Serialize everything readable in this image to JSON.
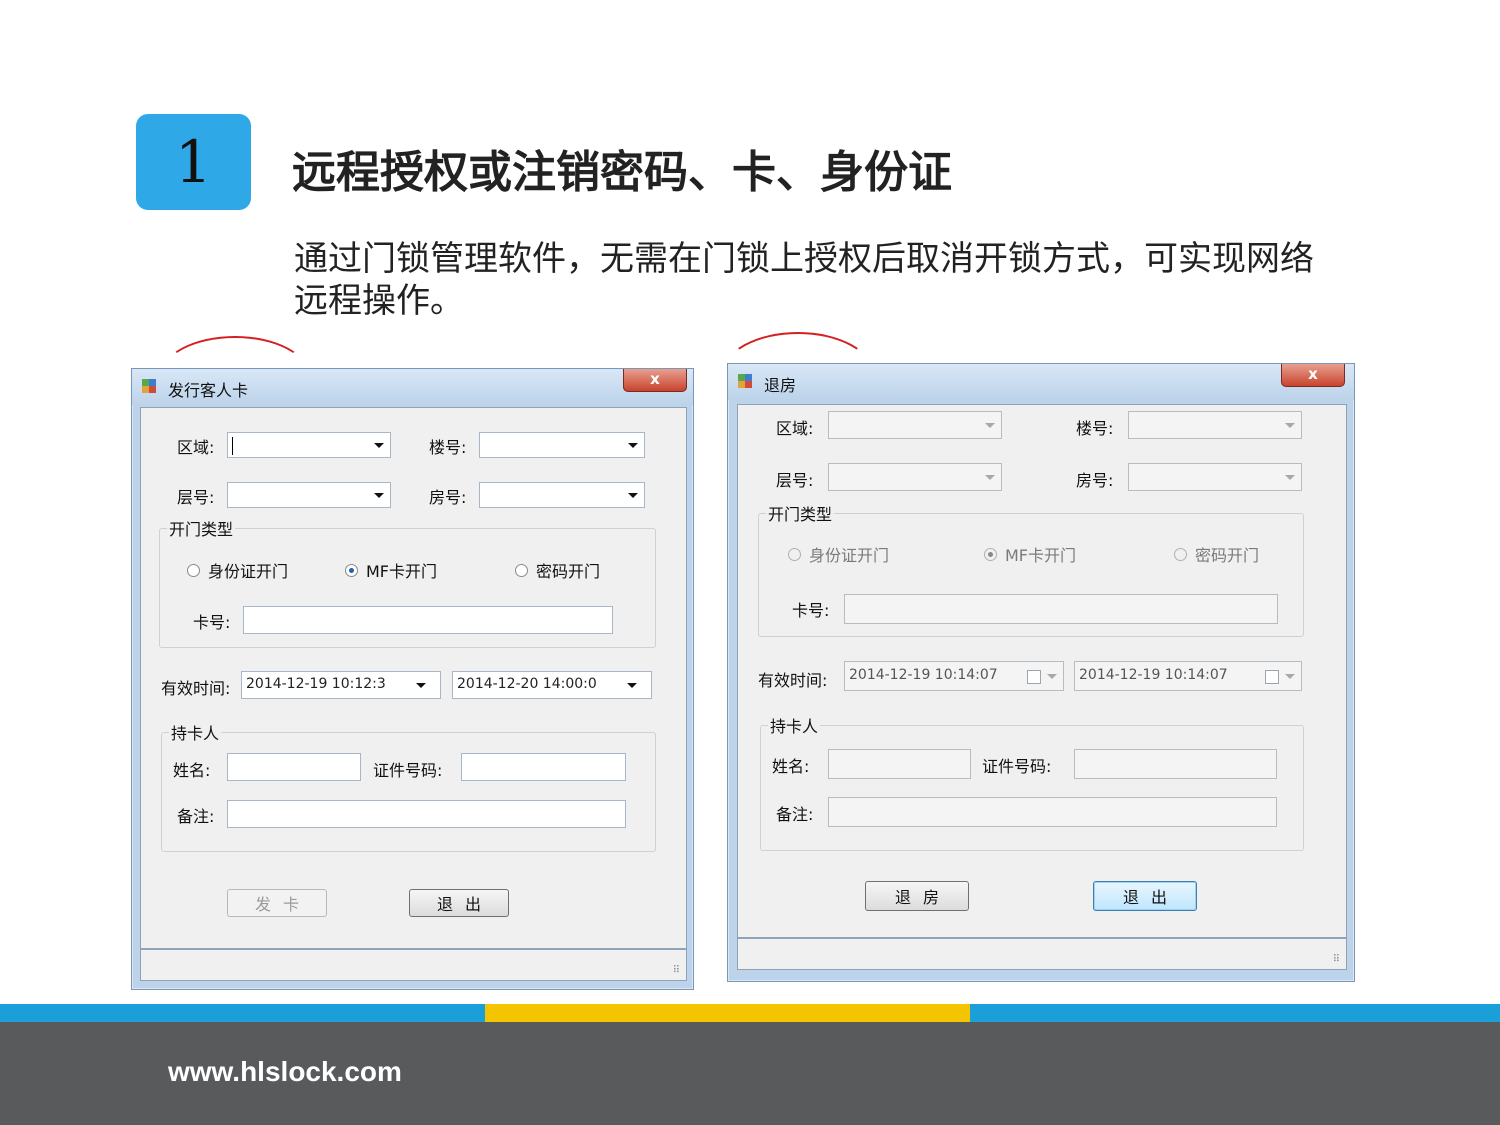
{
  "slide": {
    "number": "1",
    "title": "远程授权或注销密码、卡、身份证",
    "description": "通过门锁管理软件，无需在门锁上授权后取消开锁方式，可实现网络远程操作。",
    "website": "www.hlslock.com"
  },
  "colors": {
    "accent_blue": "#2ea8e6",
    "bar_blue": "#1a9fd8",
    "bar_yellow": "#f5c400",
    "footer_gray": "#595a5c",
    "annotation_red": "#d42020"
  },
  "issue_window": {
    "title": "发行客人卡",
    "close_label": "x",
    "area_label": "区域:",
    "building_label": "楼号:",
    "floor_label": "层号:",
    "room_label": "房号:",
    "open_type_group": "开门类型",
    "radio_id": "身份证开门",
    "radio_mf": "MF卡开门",
    "radio_pwd": "密码开门",
    "selected_radio": "MF卡开门",
    "card_label": "卡号:",
    "valid_time_label": "有效时间:",
    "start_time": "2014-12-19 10:12:3",
    "end_time": "2014-12-20 14:00:0",
    "holder_group": "持卡人",
    "name_label": "姓名:",
    "id_number_label": "证件号码:",
    "remark_label": "备注:",
    "issue_button": "发卡",
    "exit_button": "退出"
  },
  "checkout_window": {
    "title": "退房",
    "close_label": "x",
    "area_label": "区域:",
    "building_label": "楼号:",
    "floor_label": "层号:",
    "room_label": "房号:",
    "open_type_group": "开门类型",
    "radio_id": "身份证开门",
    "radio_mf": "MF卡开门",
    "radio_pwd": "密码开门",
    "selected_radio": "MF卡开门",
    "card_label": "卡号:",
    "valid_time_label": "有效时间:",
    "start_time": "2014-12-19 10:14:07",
    "end_time": "2014-12-19 10:14:07",
    "holder_group": "持卡人",
    "name_label": "姓名:",
    "id_number_label": "证件号码:",
    "remark_label": "备注:",
    "checkout_button": "退房",
    "exit_button": "退出"
  }
}
